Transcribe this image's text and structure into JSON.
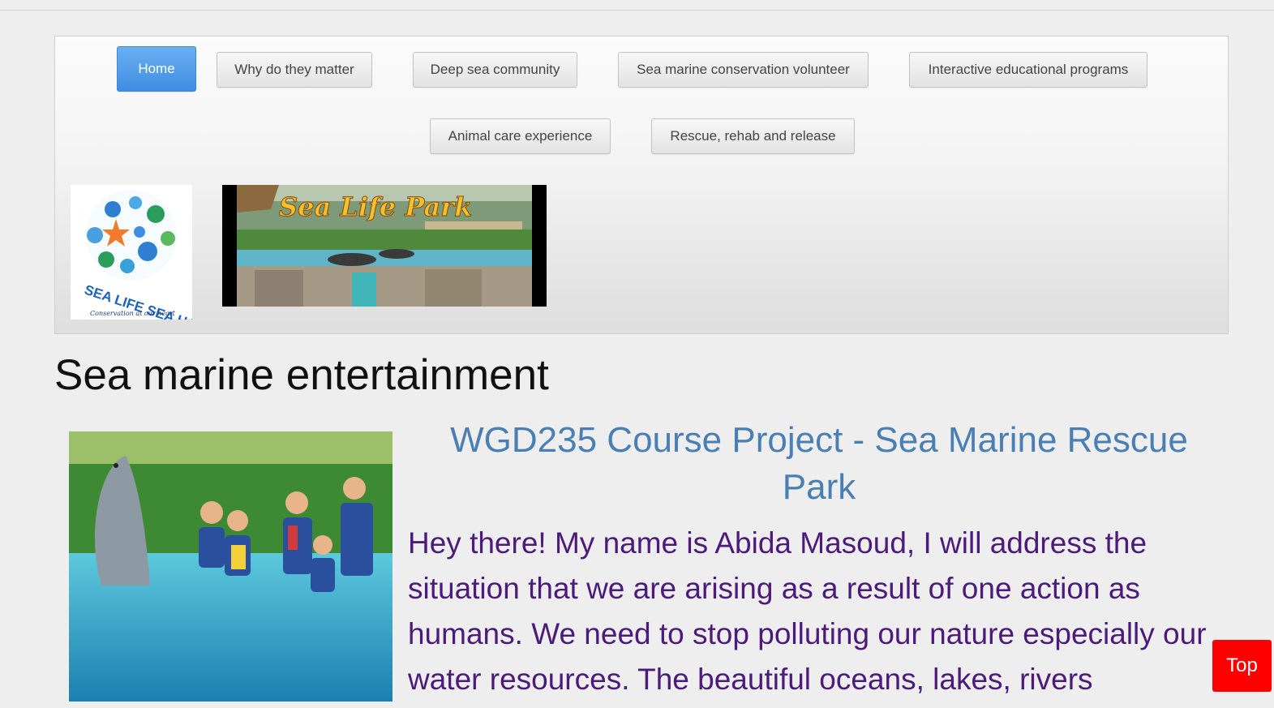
{
  "nav": {
    "items": [
      {
        "label": "Home",
        "active": true
      },
      {
        "label": "Why do they matter"
      },
      {
        "label": "Deep sea community"
      },
      {
        "label": "Sea marine conservation volunteer"
      },
      {
        "label": "Interactive educational programs"
      },
      {
        "label": "Animal care experience"
      },
      {
        "label": "Rescue, rehab and release"
      }
    ]
  },
  "logo": {
    "line1": "SEA LIFE SEA HAPPY",
    "line2": "Conservation at our heart"
  },
  "banner": {
    "text": "Sea Life Park"
  },
  "main": {
    "page_title": "Sea marine entertainment",
    "course_title": "WGD235 Course Project - Sea Marine Rescue Park",
    "intro": "Hey there! My name is Abida Masoud, I will address the situation that we are arising as a result of one action as humans. We need to stop polluting our nature especially our water resources. The beautiful oceans, lakes, rivers"
  },
  "scroll_top": {
    "label": "Top"
  },
  "colors": {
    "active_nav": "#4a96e8",
    "course_title": "#4a7fb3",
    "intro_text": "#4b1a7a",
    "top_button": "#ff0000"
  }
}
